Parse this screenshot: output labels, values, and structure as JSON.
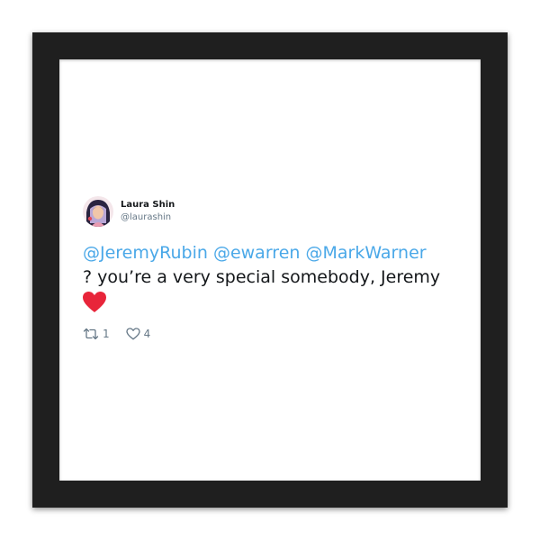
{
  "tweet": {
    "author": {
      "display_name": "Laura Shin",
      "handle": "@laurashin",
      "avatar_icon": "avatar"
    },
    "mentions": [
      "@JeremyRubin",
      "@ewarren",
      "@MarkWarner"
    ],
    "text": "? you’re a very special somebody, Jeremy",
    "emoji_icon": "red-heart-icon",
    "retweet_count": "1",
    "like_count": "4"
  },
  "colors": {
    "frame": "#1f1f1f",
    "mention": "#4aa8e8",
    "heart": "#e0245e",
    "muted": "#657786"
  }
}
